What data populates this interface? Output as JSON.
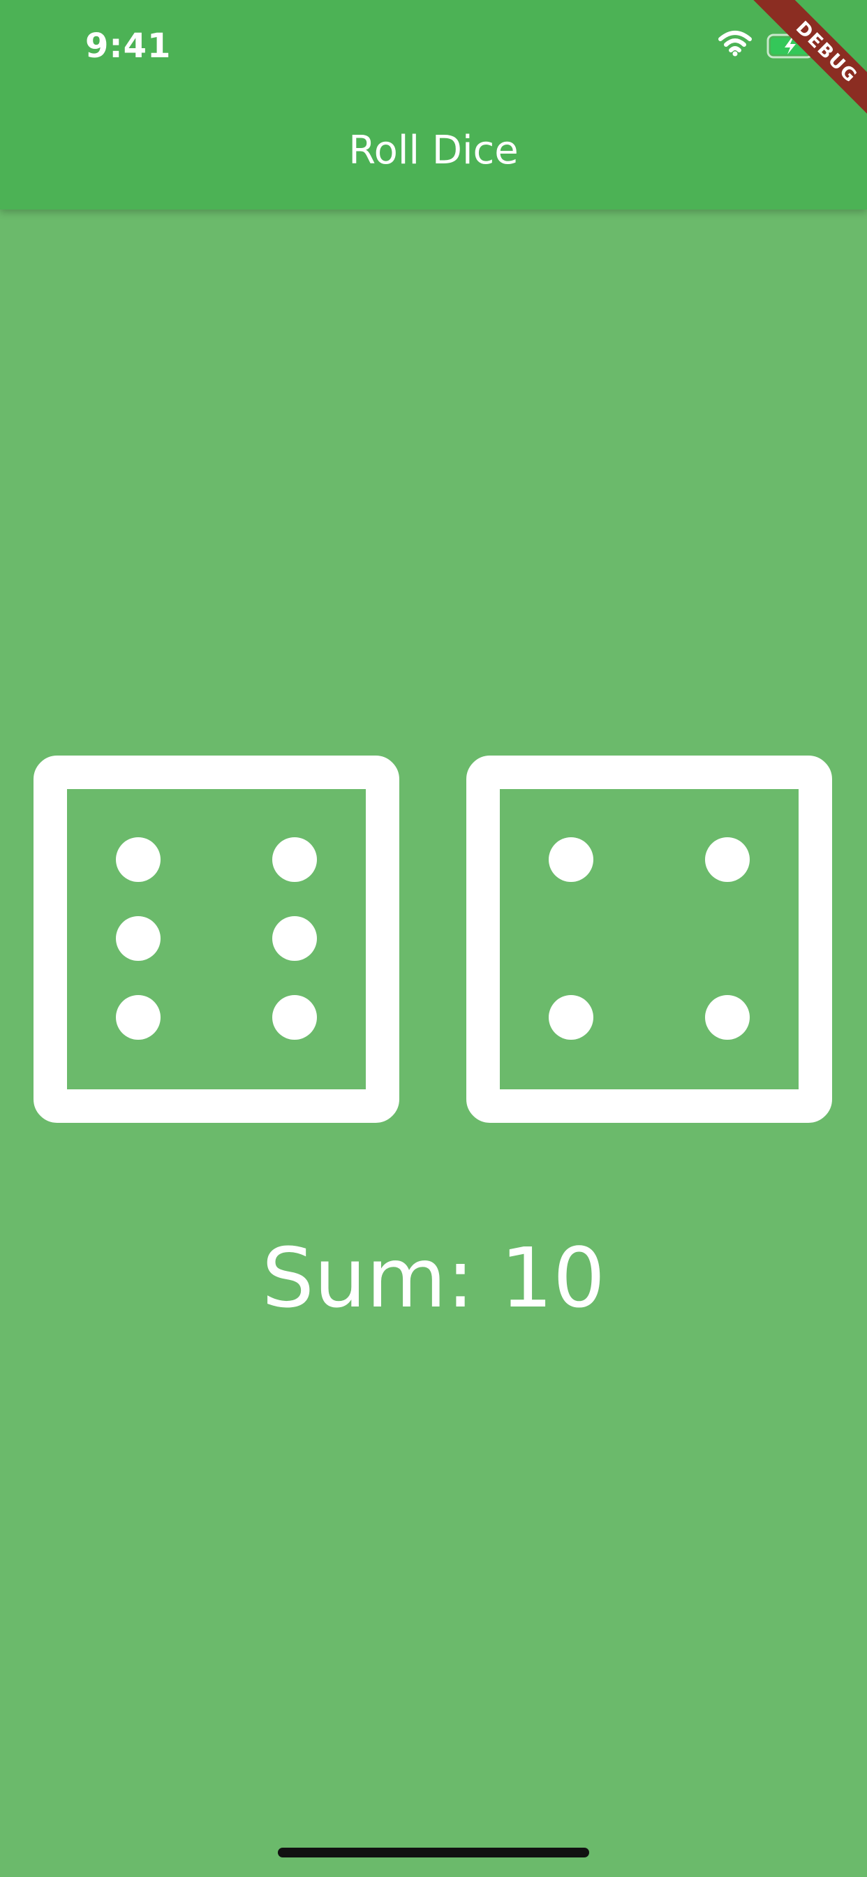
{
  "status_bar": {
    "time": "9:41"
  },
  "app_bar": {
    "title": "Roll Dice"
  },
  "debug_banner": {
    "label": "DEBUG"
  },
  "dice": [
    {
      "face": 6
    },
    {
      "face": 4
    }
  ],
  "sum_label": "Sum: 10",
  "colors": {
    "app_bar": "#4cb255",
    "background": "#6bba6b",
    "foreground": "#ffffff",
    "debug_banner": "#8b2d22",
    "battery": "#34c759"
  },
  "icons": {
    "wifi": "wifi-icon",
    "battery": "battery-charging-icon"
  }
}
